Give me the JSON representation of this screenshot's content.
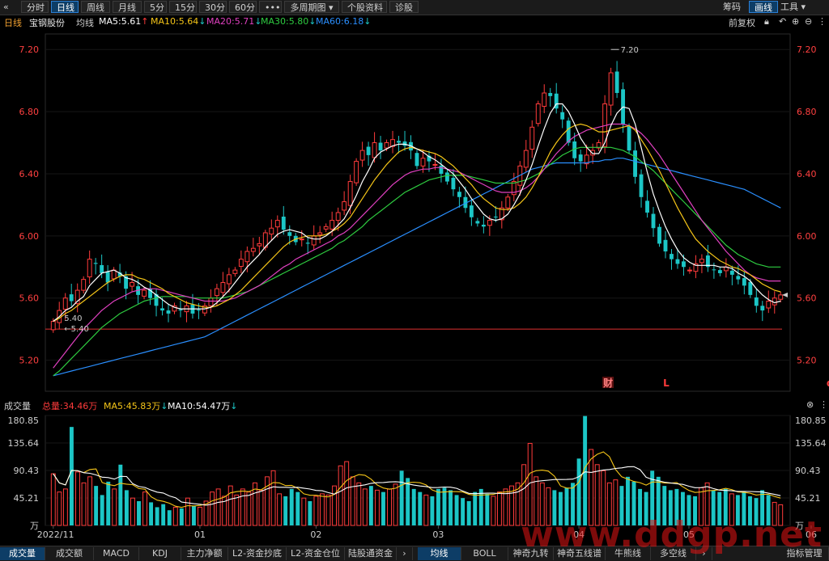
{
  "toolbar": {
    "back_icon": "double-chevron-left-icon",
    "tabs": [
      {
        "label": "分时",
        "active": false
      },
      {
        "label": "日线",
        "active": true
      },
      {
        "label": "周线",
        "active": false
      },
      {
        "label": "月线",
        "active": false
      },
      {
        "label": "5分",
        "active": false
      },
      {
        "label": "15分",
        "active": false
      },
      {
        "label": "30分",
        "active": false
      },
      {
        "label": "60分",
        "active": false
      },
      {
        "label": "•••",
        "active": false
      },
      {
        "label": "多周期图 ▾",
        "active": false
      },
      {
        "label": "个股资料",
        "active": false
      },
      {
        "label": "诊股",
        "active": false
      }
    ],
    "right": {
      "chips": "筹码",
      "draw": "画线",
      "tools": "工具 ▾"
    }
  },
  "info": {
    "period": "日线",
    "stock_name": "宝钢股份",
    "avg_label": "均线",
    "ma5": "MA5:5.61",
    "ma10": "MA10:5.64",
    "ma20": "MA20:5.71",
    "ma30": "MA30:5.80",
    "ma60": "MA60:6.18",
    "adjust": "前复权",
    "colors": {
      "ma5": "#ffffff",
      "ma10": "#f5c518",
      "ma20": "#e040c0",
      "ma30": "#2ecc40",
      "ma60": "#2a8fff",
      "up": "#ff3b3b",
      "down": "#1cc6c6"
    }
  },
  "volume_header": {
    "title": "成交量",
    "total": "总量:34.46万",
    "ma5": "MA5:45.83万",
    "ma10": "MA10:54.47万"
  },
  "chart_data": [
    {
      "type": "candlestick",
      "title": "宝钢股份 日线",
      "ylim": [
        5.0,
        7.3
      ],
      "y_ticks": [
        "7.20",
        "6.80",
        "6.40",
        "6.00",
        "5.60",
        "5.20"
      ],
      "y_tick_values": [
        7.2,
        6.8,
        6.4,
        6.0,
        5.6,
        5.2
      ],
      "horizontal_line": 5.4,
      "annotations": [
        {
          "text": "7.20",
          "value": 7.2,
          "note": "max"
        },
        {
          "text": "5.40",
          "value": 5.4,
          "note": "min"
        }
      ],
      "event_markers": [
        "财",
        "L",
        "q"
      ],
      "closes": [
        5.45,
        5.52,
        5.6,
        5.58,
        5.65,
        5.72,
        5.85,
        5.82,
        5.76,
        5.7,
        5.78,
        5.74,
        5.66,
        5.7,
        5.62,
        5.65,
        5.6,
        5.55,
        5.52,
        5.5,
        5.55,
        5.52,
        5.55,
        5.5,
        5.52,
        5.55,
        5.6,
        5.66,
        5.7,
        5.75,
        5.78,
        5.85,
        5.9,
        5.92,
        5.95,
        6.02,
        6.05,
        6.1,
        6.04,
        6.0,
        5.96,
        5.98,
        5.95,
        6.0,
        6.02,
        6.06,
        6.1,
        6.15,
        6.22,
        6.35,
        6.48,
        6.55,
        6.52,
        6.6,
        6.55,
        6.6,
        6.62,
        6.6,
        6.58,
        6.55,
        6.45,
        6.5,
        6.48,
        6.46,
        6.4,
        6.35,
        6.3,
        6.25,
        6.18,
        6.12,
        6.08,
        6.06,
        6.1,
        6.12,
        6.18,
        6.25,
        6.35,
        6.45,
        6.55,
        6.7,
        6.85,
        6.92,
        6.9,
        6.82,
        6.75,
        6.6,
        6.5,
        6.48,
        6.52,
        6.55,
        6.6,
        6.85,
        7.05,
        6.92,
        6.72,
        6.55,
        6.38,
        6.25,
        6.15,
        6.05,
        5.95,
        5.9,
        5.85,
        5.82,
        5.8,
        5.78,
        5.82,
        5.85,
        5.8,
        5.78,
        5.76,
        5.8,
        5.75,
        5.72,
        5.68,
        5.62,
        5.55,
        5.52,
        5.58,
        5.6,
        5.62
      ],
      "ma5": [
        5.45,
        5.48,
        5.52,
        5.54,
        5.58,
        5.61,
        5.68,
        5.72,
        5.76,
        5.77,
        5.78,
        5.76,
        5.73,
        5.72,
        5.7,
        5.67,
        5.65,
        5.62,
        5.59,
        5.56,
        5.54,
        5.53,
        5.53,
        5.53,
        5.53,
        5.53,
        5.54,
        5.57,
        5.61,
        5.65,
        5.7,
        5.75,
        5.8,
        5.84,
        5.88,
        5.93,
        5.97,
        6.01,
        6.03,
        6.04,
        6.03,
        6.02,
        5.99,
        5.98,
        5.98,
        6.0,
        6.03,
        6.07,
        6.11,
        6.18,
        6.26,
        6.35,
        6.42,
        6.5,
        6.54,
        6.56,
        6.58,
        6.59,
        6.59,
        6.58,
        6.56,
        6.54,
        6.51,
        6.49,
        6.46,
        6.43,
        6.4,
        6.35,
        6.3,
        6.24,
        6.19,
        6.14,
        6.11,
        6.1,
        6.11,
        6.14,
        6.2,
        6.27,
        6.36,
        6.46,
        6.58,
        6.69,
        6.79,
        6.85,
        6.85,
        6.8,
        6.72,
        6.63,
        6.57,
        6.53,
        6.53,
        6.6,
        6.71,
        6.79,
        6.83,
        6.82,
        6.72,
        6.57,
        6.41,
        6.27,
        6.16,
        6.06,
        5.98,
        5.91,
        5.86,
        5.83,
        5.81,
        5.81,
        5.81,
        5.81,
        5.8,
        5.8,
        5.79,
        5.76,
        5.74,
        5.71,
        5.66,
        5.62,
        5.59,
        5.57,
        5.58
      ],
      "ma10": [
        5.45,
        5.47,
        5.5,
        5.52,
        5.55,
        5.58,
        5.61,
        5.64,
        5.67,
        5.7,
        5.72,
        5.74,
        5.75,
        5.75,
        5.73,
        5.72,
        5.7,
        5.68,
        5.66,
        5.63,
        5.61,
        5.59,
        5.57,
        5.56,
        5.55,
        5.54,
        5.54,
        5.55,
        5.57,
        5.59,
        5.62,
        5.65,
        5.69,
        5.73,
        5.77,
        5.81,
        5.85,
        5.89,
        5.93,
        5.96,
        5.98,
        5.99,
        6.0,
        6.0,
        6.0,
        6.01,
        6.03,
        6.05,
        6.08,
        6.12,
        6.18,
        6.24,
        6.3,
        6.36,
        6.41,
        6.46,
        6.5,
        6.54,
        6.56,
        6.57,
        6.56,
        6.55,
        6.54,
        6.53,
        6.51,
        6.48,
        6.45,
        6.41,
        6.37,
        6.33,
        6.28,
        6.24,
        6.21,
        6.18,
        6.17,
        6.17,
        6.18,
        6.21,
        6.25,
        6.31,
        6.38,
        6.46,
        6.54,
        6.6,
        6.65,
        6.69,
        6.71,
        6.72,
        6.71,
        6.69,
        6.67,
        6.67,
        6.68,
        6.69,
        6.7,
        6.71,
        6.68,
        6.62,
        6.56,
        6.49,
        6.42,
        6.34,
        6.26,
        6.18,
        6.11,
        6.04,
        5.98,
        5.94,
        5.9,
        5.87,
        5.84,
        5.82,
        5.8,
        5.79,
        5.77,
        5.75,
        5.72,
        5.69,
        5.67,
        5.65,
        5.64
      ],
      "ma20": [
        5.15,
        5.2,
        5.25,
        5.3,
        5.35,
        5.4,
        5.44,
        5.48,
        5.52,
        5.55,
        5.58,
        5.6,
        5.62,
        5.64,
        5.65,
        5.66,
        5.66,
        5.66,
        5.65,
        5.64,
        5.63,
        5.62,
        5.61,
        5.6,
        5.59,
        5.58,
        5.58,
        5.58,
        5.58,
        5.59,
        5.6,
        5.62,
        5.64,
        5.66,
        5.68,
        5.71,
        5.74,
        5.77,
        5.8,
        5.82,
        5.85,
        5.87,
        5.89,
        5.91,
        5.93,
        5.95,
        5.97,
        6.0,
        6.02,
        6.05,
        6.09,
        6.13,
        6.17,
        6.21,
        6.25,
        6.29,
        6.33,
        6.36,
        6.39,
        6.41,
        6.42,
        6.43,
        6.43,
        6.44,
        6.44,
        6.43,
        6.42,
        6.41,
        6.39,
        6.37,
        6.35,
        6.33,
        6.31,
        6.29,
        6.28,
        6.28,
        6.28,
        6.29,
        6.31,
        6.34,
        6.38,
        6.43,
        6.48,
        6.53,
        6.57,
        6.61,
        6.64,
        6.66,
        6.68,
        6.69,
        6.7,
        6.71,
        6.72,
        6.72,
        6.72,
        6.71,
        6.69,
        6.66,
        6.62,
        6.57,
        6.52,
        6.46,
        6.4,
        6.34,
        6.28,
        6.22,
        6.16,
        6.1,
        6.05,
        6.0,
        5.95,
        5.9,
        5.86,
        5.82,
        5.78,
        5.75,
        5.73,
        5.72,
        5.71,
        5.71,
        5.71
      ],
      "ma30": [
        5.1,
        5.13,
        5.17,
        5.21,
        5.25,
        5.29,
        5.33,
        5.37,
        5.41,
        5.44,
        5.47,
        5.5,
        5.52,
        5.54,
        5.56,
        5.58,
        5.59,
        5.6,
        5.61,
        5.61,
        5.61,
        5.61,
        5.61,
        5.6,
        5.6,
        5.6,
        5.6,
        5.6,
        5.6,
        5.61,
        5.62,
        5.63,
        5.64,
        5.66,
        5.68,
        5.7,
        5.72,
        5.74,
        5.76,
        5.78,
        5.8,
        5.82,
        5.84,
        5.86,
        5.88,
        5.9,
        5.92,
        5.95,
        5.97,
        6.0,
        6.03,
        6.06,
        6.1,
        6.13,
        6.16,
        6.19,
        6.22,
        6.25,
        6.28,
        6.3,
        6.32,
        6.34,
        6.36,
        6.37,
        6.38,
        6.39,
        6.39,
        6.39,
        6.39,
        6.38,
        6.37,
        6.36,
        6.35,
        6.34,
        6.34,
        6.34,
        6.34,
        6.35,
        6.36,
        6.38,
        6.4,
        6.43,
        6.46,
        6.49,
        6.52,
        6.54,
        6.56,
        6.57,
        6.57,
        6.57,
        6.57,
        6.57,
        6.57,
        6.56,
        6.55,
        6.53,
        6.51,
        6.48,
        6.45,
        6.42,
        6.38,
        6.34,
        6.3,
        6.26,
        6.22,
        6.18,
        6.14,
        6.1,
        6.06,
        6.02,
        5.98,
        5.94,
        5.91,
        5.88,
        5.86,
        5.84,
        5.82,
        5.81,
        5.8,
        5.8,
        5.8
      ],
      "ma60": [
        5.1,
        5.11,
        5.12,
        5.13,
        5.14,
        5.15,
        5.16,
        5.17,
        5.18,
        5.19,
        5.2,
        5.21,
        5.22,
        5.23,
        5.24,
        5.25,
        5.26,
        5.27,
        5.28,
        5.29,
        5.3,
        5.31,
        5.32,
        5.33,
        5.34,
        5.35,
        5.37,
        5.39,
        5.41,
        5.43,
        5.45,
        5.47,
        5.49,
        5.51,
        5.53,
        5.55,
        5.57,
        5.59,
        5.61,
        5.63,
        5.65,
        5.67,
        5.69,
        5.71,
        5.73,
        5.75,
        5.77,
        5.79,
        5.81,
        5.83,
        5.85,
        5.87,
        5.89,
        5.91,
        5.93,
        5.95,
        5.97,
        5.99,
        6.01,
        6.03,
        6.05,
        6.07,
        6.09,
        6.11,
        6.13,
        6.15,
        6.17,
        6.19,
        6.21,
        6.23,
        6.25,
        6.27,
        6.29,
        6.31,
        6.33,
        6.35,
        6.37,
        6.39,
        6.41,
        6.43,
        6.44,
        6.45,
        6.46,
        6.47,
        6.47,
        6.47,
        6.47,
        6.47,
        6.47,
        6.48,
        6.48,
        6.49,
        6.49,
        6.5,
        6.5,
        6.49,
        6.48,
        6.47,
        6.46,
        6.45,
        6.44,
        6.43,
        6.42,
        6.41,
        6.4,
        6.39,
        6.38,
        6.37,
        6.36,
        6.35,
        6.34,
        6.33,
        6.32,
        6.31,
        6.3,
        6.28,
        6.26,
        6.24,
        6.22,
        6.2,
        6.18
      ]
    },
    {
      "type": "bar",
      "title": "成交量",
      "unit": "万",
      "ylim": [
        0,
        180.85
      ],
      "y_ticks": [
        "180.85",
        "135.64",
        "90.43",
        "45.21",
        "万"
      ],
      "y_tick_values": [
        180.85,
        135.64,
        90.43,
        45.21,
        0
      ],
      "x_ticks": [
        "2022/11",
        "01",
        "02",
        "03",
        "04",
        "05",
        "06"
      ],
      "x_tick_index": [
        0,
        24,
        43,
        63,
        86,
        104,
        124
      ],
      "values": [
        85,
        55,
        60,
        162,
        88,
        70,
        80,
        65,
        50,
        72,
        60,
        100,
        58,
        45,
        40,
        55,
        38,
        30,
        35,
        25,
        30,
        28,
        45,
        32,
        30,
        40,
        55,
        60,
        48,
        65,
        50,
        60,
        55,
        70,
        58,
        80,
        90,
        52,
        48,
        60,
        55,
        45,
        40,
        48,
        52,
        50,
        65,
        98,
        105,
        80,
        70,
        60,
        65,
        58,
        55,
        60,
        68,
        90,
        78,
        60,
        55,
        50,
        48,
        60,
        62,
        58,
        50,
        45,
        40,
        55,
        60,
        52,
        48,
        55,
        60,
        65,
        70,
        100,
        135,
        80,
        70,
        62,
        58,
        55,
        62,
        70,
        110,
        180,
        125,
        100,
        90,
        70,
        75,
        65,
        80,
        72,
        60,
        55,
        90,
        80,
        65,
        58,
        60,
        55,
        50,
        48,
        62,
        70,
        58,
        55,
        60,
        52,
        50,
        55,
        48,
        45,
        58,
        50,
        38,
        34
      ]
    }
  ]
}
